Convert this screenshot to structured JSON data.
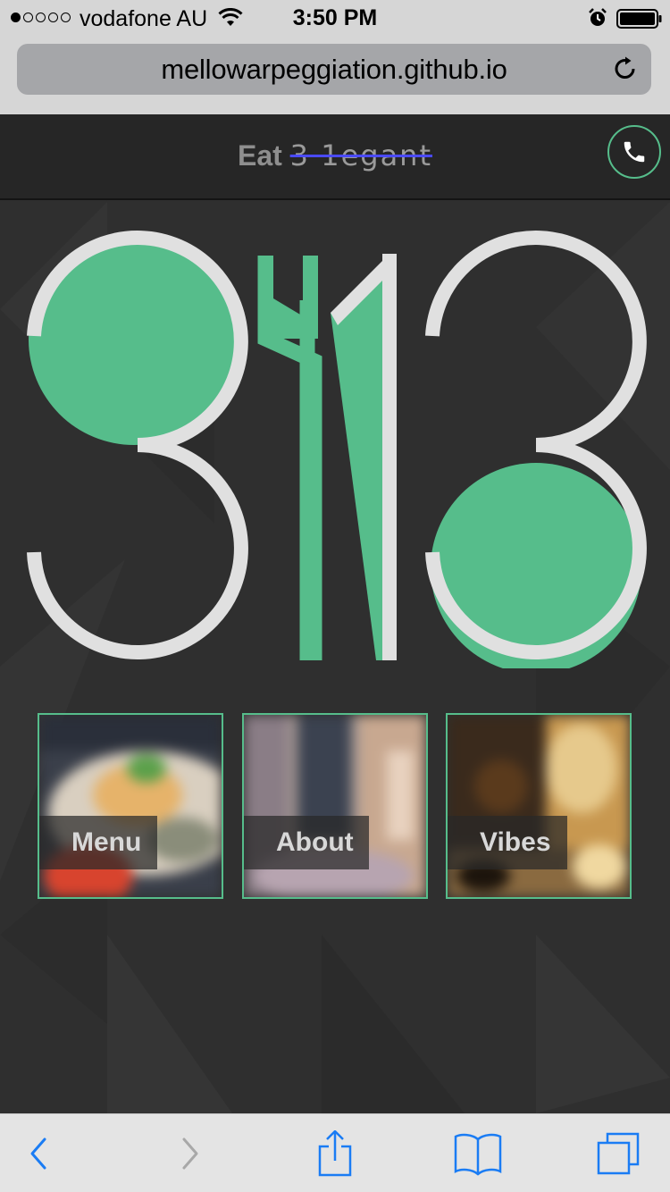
{
  "status_bar": {
    "carrier": "vodafone AU",
    "time": "3:50 PM"
  },
  "browser": {
    "url": "mellowarpeggiation.github.io"
  },
  "header": {
    "brand_prefix": "Eat",
    "brand_logotype": "3 1egant"
  },
  "logo": {
    "alt_text": "3113"
  },
  "tiles": [
    {
      "label": "Menu"
    },
    {
      "label": "About"
    },
    {
      "label": "Vibes"
    }
  ],
  "colors": {
    "accent": "#56bd8b",
    "logo_stroke": "#e0e0e0",
    "background": "#2f2f2f",
    "header": "#262626",
    "ios_blue": "#1a7cf4"
  },
  "icons": {
    "header": [
      "phone-icon"
    ],
    "toolbar": [
      "back-icon",
      "forward-icon",
      "share-icon",
      "bookmarks-icon",
      "tabs-icon"
    ]
  }
}
